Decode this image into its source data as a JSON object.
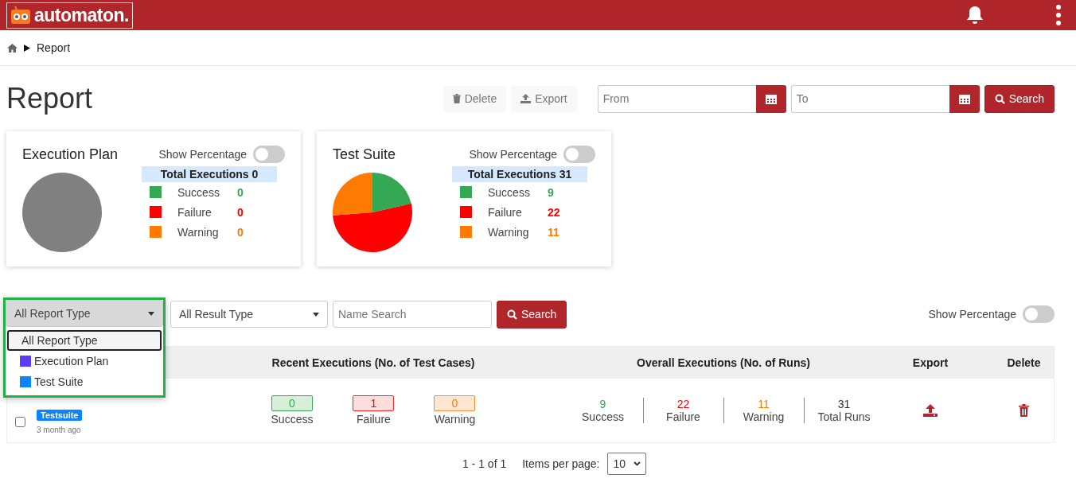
{
  "header": {
    "logo_text": "automaton."
  },
  "breadcrumb": {
    "items": [
      "Report"
    ]
  },
  "page_title": "Report",
  "actions": [
    {
      "label": "Delete",
      "kind": "delete"
    },
    {
      "label": "Export",
      "kind": "export"
    }
  ],
  "date_range": {
    "from_placeholder": "From",
    "to_placeholder": "To",
    "search_label": "Search"
  },
  "summary_cards": [
    {
      "title": "Execution Plan",
      "toggle_label": "Show Percentage",
      "on": false,
      "total_label": "Total Executions 0",
      "stats": [
        {
          "label": "Success",
          "value": "0",
          "color": "#34a853"
        },
        {
          "label": "Failure",
          "value": "0",
          "color": "#ff0000"
        },
        {
          "label": "Warning",
          "value": "0",
          "color": "#ff7a00"
        }
      ]
    },
    {
      "title": "Test Suite",
      "toggle_label": "Show Percentage",
      "on": false,
      "total_label": "Total Executions 31",
      "stats": [
        {
          "label": "Success",
          "value": "9",
          "color": "#34a853"
        },
        {
          "label": "Failure",
          "value": "22",
          "color": "#ff0000"
        },
        {
          "label": "Warning",
          "value": "11",
          "color": "#ff7a00"
        }
      ]
    }
  ],
  "filters": {
    "report_type": {
      "value": "All Report Type",
      "expanded": true,
      "options": [
        {
          "label": "All Report Type",
          "selected": true
        },
        {
          "label": "Execution Plan",
          "selected": false,
          "color": "#5b3cff"
        },
        {
          "label": "Test Suite",
          "selected": false,
          "color": "#0a84ff"
        }
      ]
    },
    "result_type": {
      "value": "All Result Type"
    },
    "name_search": {
      "placeholder": "Name Search"
    },
    "search_label": "Search",
    "toggle_label": "Show Percentage",
    "on": false
  },
  "table": {
    "columns": [
      "Recent Executions (No. of Test Cases)",
      "Overall Executions (No. of Runs)",
      "Export",
      "Delete"
    ],
    "rows": [
      {
        "checked": false,
        "tag": "Testsuite",
        "time": "3 month ago",
        "recent": [
          {
            "value": "0",
            "label": "Success",
            "kind": "success"
          },
          {
            "value": "1",
            "label": "Failure",
            "kind": "failure"
          },
          {
            "value": "0",
            "label": "Warning",
            "kind": "warning"
          }
        ],
        "overall": [
          {
            "value": "9",
            "label": "Success",
            "kind": "success"
          },
          {
            "value": "22",
            "label": "Failure",
            "kind": "failure"
          },
          {
            "value": "11",
            "label": "Warning",
            "kind": "warning"
          },
          {
            "value": "31",
            "label": "Total Runs",
            "kind": "total"
          }
        ]
      }
    ]
  },
  "pagination": {
    "range": "1 - 1 of 1",
    "items_label": "Items per page:",
    "page_size": "10"
  }
}
